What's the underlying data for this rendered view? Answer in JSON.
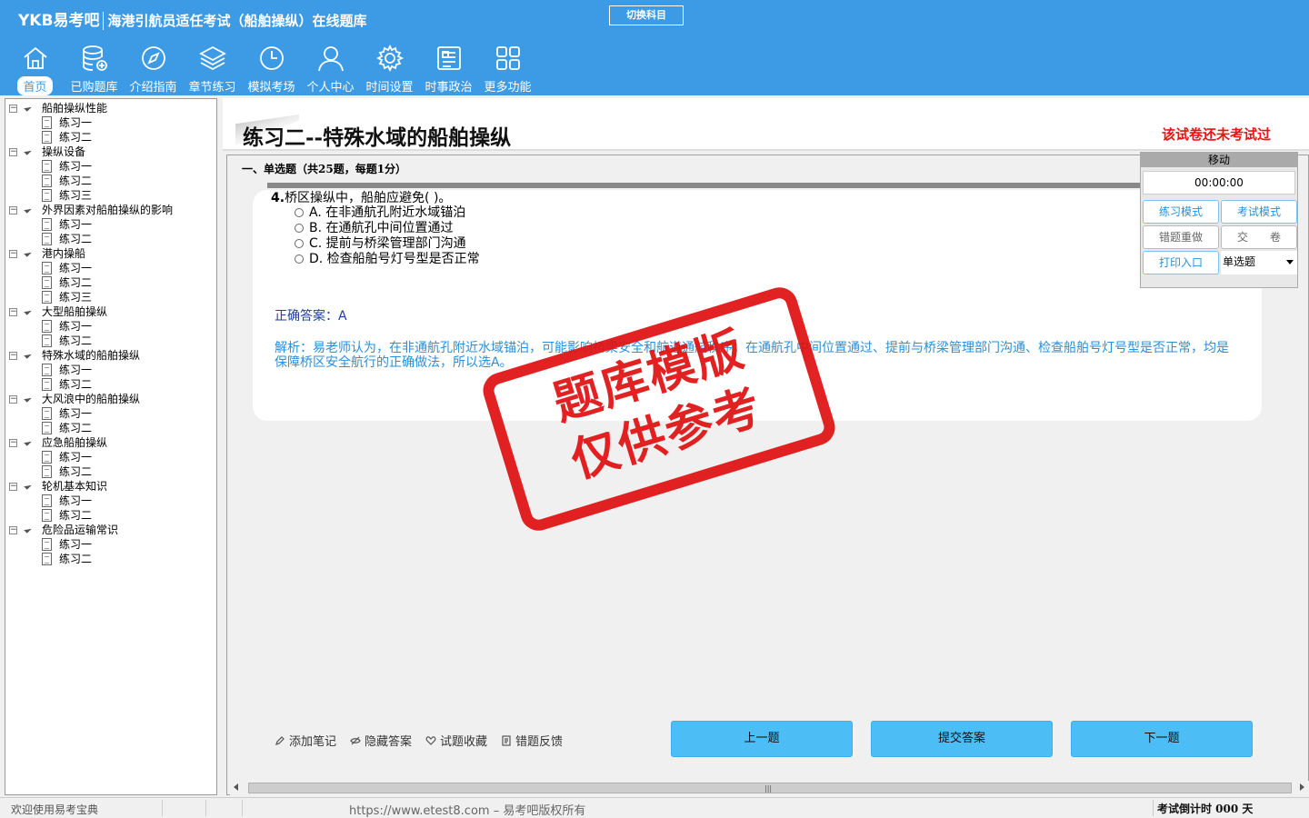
{
  "header": {
    "brand": "YKB易考吧",
    "app_title": "海港引航员适任考试（船舶操纵）在线题库",
    "switch_subject": "切换科目"
  },
  "nav": [
    {
      "label": "首页",
      "icon": "home-icon",
      "active": true
    },
    {
      "label": "已购题库",
      "icon": "database-icon",
      "active": false
    },
    {
      "label": "介绍指南",
      "icon": "compass-icon",
      "active": false
    },
    {
      "label": "章节练习",
      "icon": "layers-icon",
      "active": false
    },
    {
      "label": "模拟考场",
      "icon": "clock-icon",
      "active": false
    },
    {
      "label": "个人中心",
      "icon": "user-icon",
      "active": false
    },
    {
      "label": "时间设置",
      "icon": "gear-icon",
      "active": false
    },
    {
      "label": "时事政治",
      "icon": "news-icon",
      "active": false
    },
    {
      "label": "更多功能",
      "icon": "grid-icon",
      "active": false
    }
  ],
  "tree": [
    {
      "label": "船舶操纵性能",
      "children": [
        "练习一",
        "练习二"
      ]
    },
    {
      "label": "操纵设备",
      "children": [
        "练习一",
        "练习二",
        "练习三"
      ]
    },
    {
      "label": "外界因素对船舶操纵的影响",
      "children": [
        "练习一",
        "练习二"
      ]
    },
    {
      "label": "港内操船",
      "children": [
        "练习一",
        "练习二",
        "练习三"
      ]
    },
    {
      "label": "大型船舶操纵",
      "children": [
        "练习一",
        "练习二"
      ]
    },
    {
      "label": "特殊水域的船舶操纵",
      "children": [
        "练习一",
        "练习二"
      ]
    },
    {
      "label": "大风浪中的船舶操纵",
      "children": [
        "练习一",
        "练习二"
      ]
    },
    {
      "label": "应急船舶操纵",
      "children": [
        "练习一",
        "练习二"
      ]
    },
    {
      "label": "轮机基本知识",
      "children": [
        "练习一",
        "练习二"
      ]
    },
    {
      "label": "危险品运输常识",
      "children": [
        "练习一",
        "练习二"
      ]
    }
  ],
  "exam": {
    "title": "练习二--特殊水域的船舶操纵",
    "status": "该试卷还未考试过",
    "section": "一、单选题（共25题，每题1分）"
  },
  "question": {
    "number": "4.",
    "text": "桥区操纵中，船舶应避免( )。",
    "options": [
      "A. 在非通航孔附近水域锚泊",
      "B. 在通航孔中间位置通过",
      "C. 提前与桥梁管理部门沟通",
      "D. 检查船舶号灯号型是否正常"
    ],
    "answer_label": "正确答案：",
    "answer_value": "A",
    "analysis": "解析：易老师认为，在非通航孔附近水域锚泊，可能影响桥梁安全和航道通航秩序；在通航孔中间位置通过、提前与桥梁管理部门沟通、检查船舶号灯号型是否正常，均是保障桥区安全航行的正确做法，所以选A。"
  },
  "panel": {
    "move": "移动",
    "timer": "00:00:00",
    "practice_mode": "练习模式",
    "exam_mode": "考试模式",
    "redo_wrong": "错题重做",
    "submit_paper": "交　　卷",
    "print": "打印入口",
    "qtype": "单选题"
  },
  "tools": {
    "note": "添加笔记",
    "hide_answer": "隐藏答案",
    "favorite": "试题收藏",
    "feedback": "错题反馈"
  },
  "buttons": {
    "prev": "上一题",
    "submit": "提交答案",
    "next": "下一题"
  },
  "status": {
    "left": "欢迎使用易考宝典",
    "url": "https://www.etest8.com – 易考吧版权所有",
    "countdown": "考试倒计时 000 天"
  },
  "stamp": {
    "line1": "题库模版",
    "line2": "仅供参考"
  }
}
